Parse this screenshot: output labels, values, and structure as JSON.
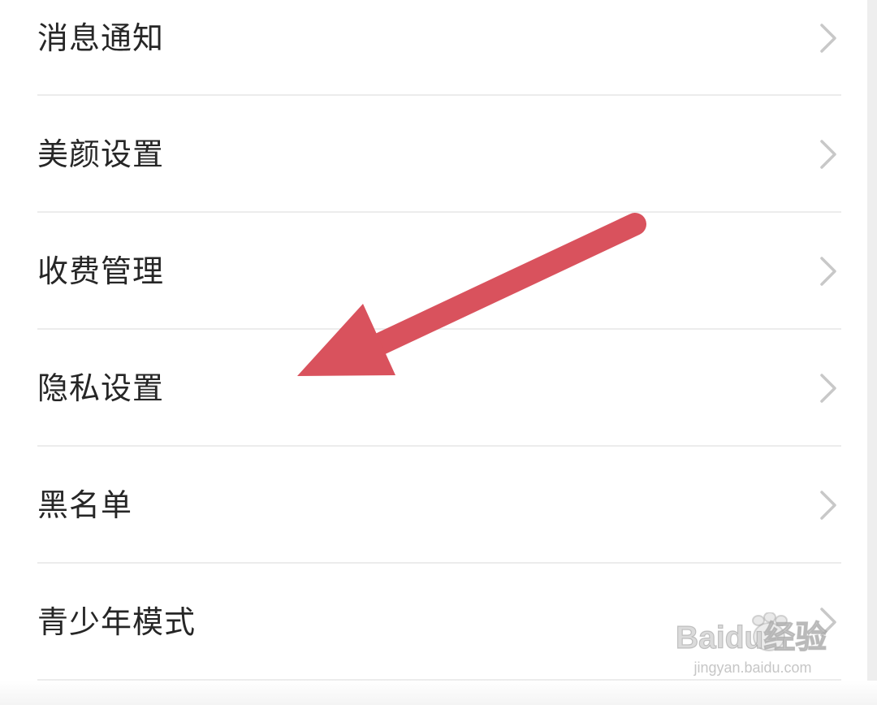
{
  "settings": {
    "items": [
      {
        "label": "消息通知"
      },
      {
        "label": "美颜设置"
      },
      {
        "label": "收费管理"
      },
      {
        "label": "隐私设置"
      },
      {
        "label": "黑名单"
      },
      {
        "label": "青少年模式"
      }
    ]
  },
  "annotation": {
    "arrow_color": "#d9525d",
    "points_to": "隐私设置"
  },
  "watermark": {
    "logo_text": "Baidu经验",
    "url": "jingyan.baidu.com"
  },
  "colors": {
    "text": "#262626",
    "divider": "#ececec",
    "chevron": "#c8c8c8",
    "background": "#ffffff"
  }
}
